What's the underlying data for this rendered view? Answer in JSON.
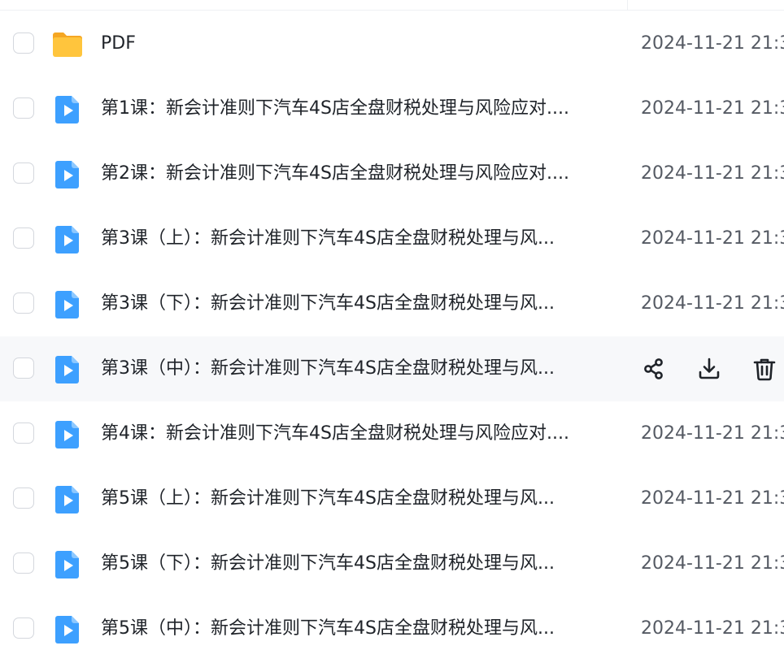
{
  "files": [
    {
      "name": "PDF",
      "type": "folder",
      "date": "2024-11-21 21:3"
    },
    {
      "name": "第1课：新会计准则下汽车4S店全盘财税处理与风险应对....",
      "type": "video",
      "date": "2024-11-21 21:3"
    },
    {
      "name": "第2课：新会计准则下汽车4S店全盘财税处理与风险应对....",
      "type": "video",
      "date": "2024-11-21 21:3"
    },
    {
      "name": "第3课（上）：新会计准则下汽车4S店全盘财税处理与风...",
      "type": "video",
      "date": "2024-11-21 21:3"
    },
    {
      "name": "第3课（下）：新会计准则下汽车4S店全盘财税处理与风...",
      "type": "video",
      "date": "2024-11-21 21:3"
    },
    {
      "name": "第3课（中）：新会计准则下汽车4S店全盘财税处理与风...",
      "type": "video",
      "date": "",
      "hovered": true
    },
    {
      "name": "第4课：新会计准则下汽车4S店全盘财税处理与风险应对....",
      "type": "video",
      "date": "2024-11-21 21:3"
    },
    {
      "name": "第5课（上）：新会计准则下汽车4S店全盘财税处理与风...",
      "type": "video",
      "date": "2024-11-21 21:3"
    },
    {
      "name": "第5课（下）：新会计准则下汽车4S店全盘财税处理与风...",
      "type": "video",
      "date": "2024-11-21 21:3"
    },
    {
      "name": "第5课（中）：新会计准则下汽车4S店全盘财税处理与风...",
      "type": "video",
      "date": "2024-11-21 21:3"
    }
  ],
  "row_actions": [
    {
      "name": "share-button",
      "icon": "share-icon"
    },
    {
      "name": "download-button",
      "icon": "download-icon"
    },
    {
      "name": "delete-button",
      "icon": "trash-icon"
    }
  ],
  "colors": {
    "folder": "#FFC53D",
    "folder_dark": "#F5A623",
    "video": "#3DA0FF",
    "video_fold": "#8CC8FF",
    "hover_bg": "#F7F8FA",
    "text": "#1F2329",
    "date_text": "#555A63",
    "icon": "#1F2329"
  }
}
